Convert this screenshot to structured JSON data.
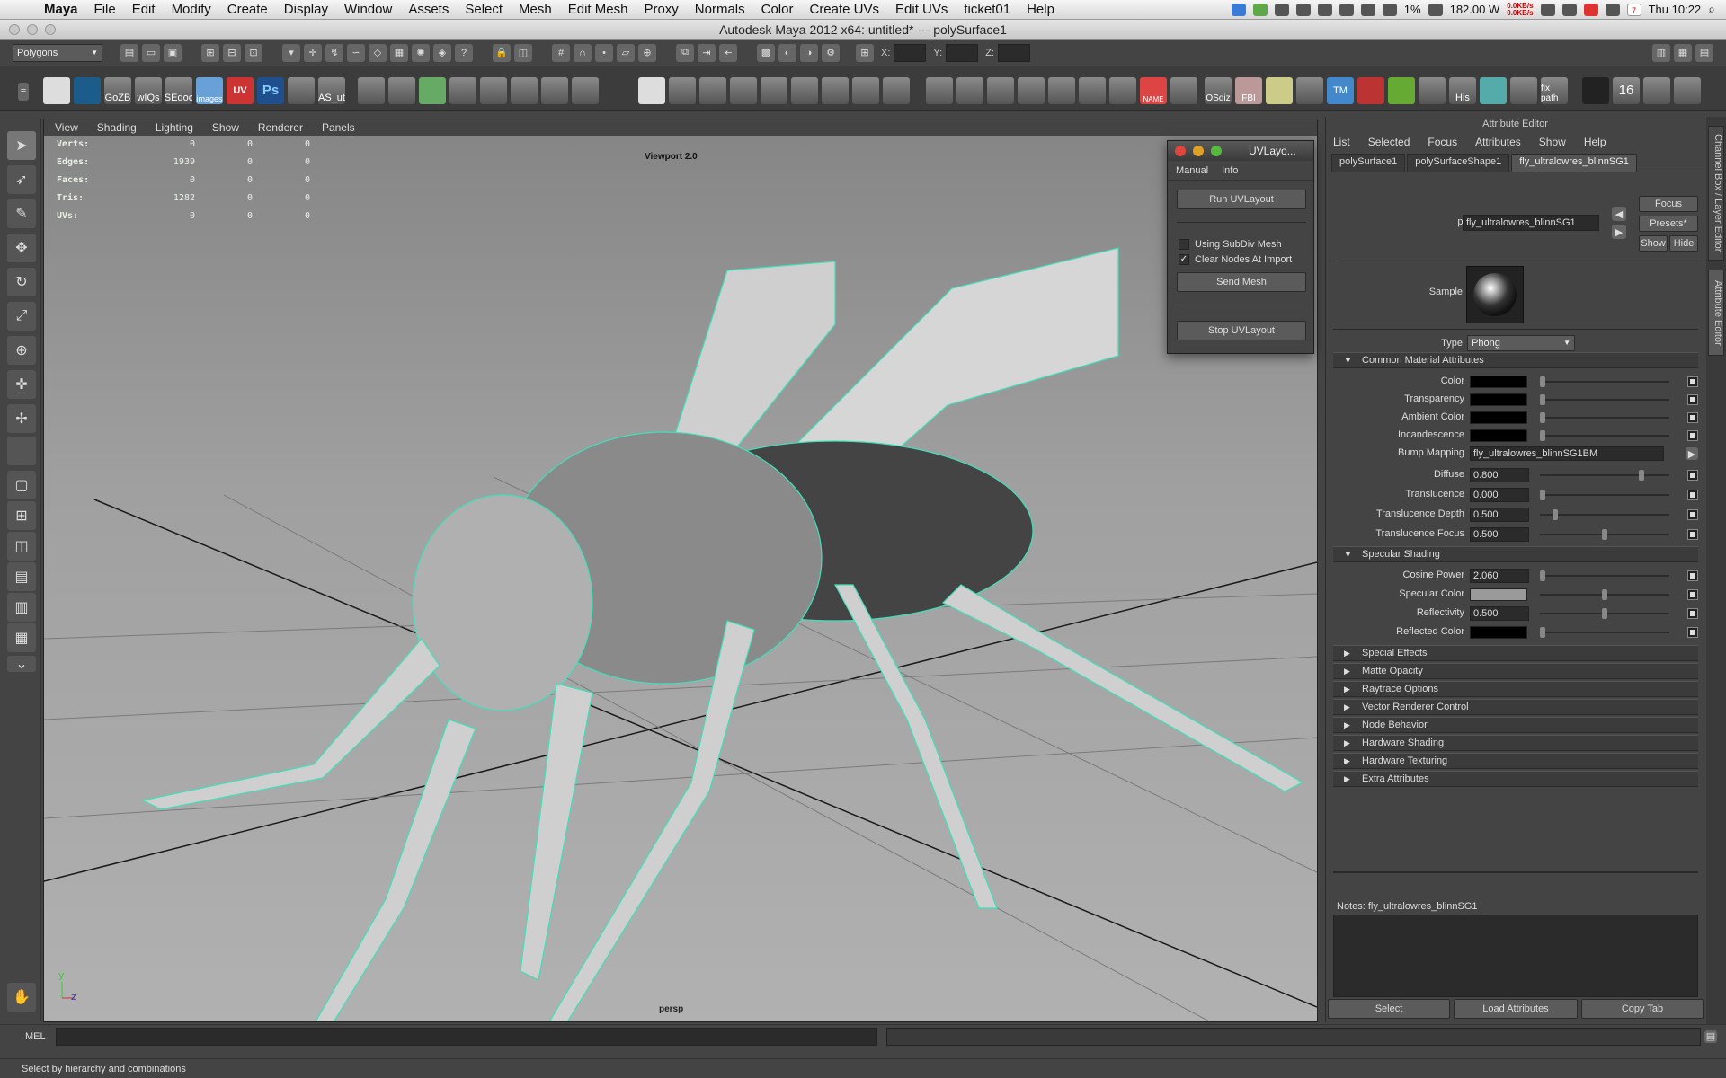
{
  "menubar": {
    "app": "Maya",
    "items": [
      "File",
      "Edit",
      "Modify",
      "Create",
      "Display",
      "Window",
      "Assets",
      "Select",
      "Mesh",
      "Edit Mesh",
      "Proxy",
      "Normals",
      "Color",
      "Create UVs",
      "Edit UVs",
      "ticket01",
      "Help"
    ],
    "battery": "1%",
    "power": "182.00 W",
    "net_up": "0.0KB/s",
    "net_down": "0.0KB/s",
    "clock": "Thu 10:22",
    "date_day": "7"
  },
  "window": {
    "title": "Autodesk Maya 2012 x64: untitled*   ---   polySurface1"
  },
  "statusline": {
    "mode": "Polygons",
    "x_label": "X:",
    "y_label": "Y:",
    "z_label": "Z:"
  },
  "shelf": {
    "icons": [
      "maya",
      "hypershade",
      "GoZB",
      "wIQs",
      "SEdoc",
      "images",
      "UV",
      "Ps",
      "AS_ut",
      "NAME",
      "OSdiz",
      "FBI",
      "TM",
      "His",
      "fix path",
      "16"
    ]
  },
  "viewport": {
    "menus": [
      "View",
      "Shading",
      "Lighting",
      "Show",
      "Renderer",
      "Panels"
    ],
    "label": "Viewport 2.0",
    "camera": "persp",
    "hud": [
      {
        "label": "Verts:",
        "values": [
          "0",
          "0",
          "0"
        ]
      },
      {
        "label": "Edges:",
        "values": [
          "1939",
          "0",
          "0"
        ]
      },
      {
        "label": "Faces:",
        "values": [
          "0",
          "0",
          "0"
        ]
      },
      {
        "label": "Tris:",
        "values": [
          "1282",
          "0",
          "0"
        ]
      },
      {
        "label": "UVs:",
        "values": [
          "0",
          "0",
          "0"
        ]
      }
    ]
  },
  "uvlayout": {
    "title": "UVLayo...",
    "menu": [
      "Manual",
      "Info"
    ],
    "run": "Run UVLayout",
    "subdiv": "Using SubDiv Mesh",
    "subdiv_checked": false,
    "clear_nodes": "Clear Nodes At Import",
    "clear_nodes_checked": true,
    "send": "Send Mesh",
    "stop": "Stop UVLayout"
  },
  "attr_editor": {
    "title": "Attribute Editor",
    "menu": [
      "List",
      "Selected",
      "Focus",
      "Attributes",
      "Show",
      "Help"
    ],
    "tabs": [
      "polySurface1",
      "polySurfaceShape1",
      "fly_ultralowres_blinnSG1"
    ],
    "node_type_label": "phong:",
    "node_name": "fly_ultralowres_blinnSG1",
    "focus": "Focus",
    "presets": "Presets*",
    "show": "Show",
    "hide": "Hide",
    "sample": "Sample",
    "type_label": "Type",
    "type_value": "Phong",
    "common_section": "Common Material Attributes",
    "common": [
      {
        "label": "Color",
        "color": "#000000"
      },
      {
        "label": "Transparency",
        "color": "#000000"
      },
      {
        "label": "Ambient Color",
        "color": "#000000"
      },
      {
        "label": "Incandescence",
        "color": "#000000"
      }
    ],
    "bump_label": "Bump Mapping",
    "bump_value": "fly_ultralowres_blinnSG1BM",
    "numeric": [
      {
        "label": "Diffuse",
        "value": "0.800",
        "fraction": 0.8
      },
      {
        "label": "Translucence",
        "value": "0.000",
        "fraction": 0.0
      },
      {
        "label": "Translucence Depth",
        "value": "0.500",
        "fraction": 0.1
      },
      {
        "label": "Translucence Focus",
        "value": "0.500",
        "fraction": 0.5
      }
    ],
    "specular_section": "Specular Shading",
    "specular": [
      {
        "label": "Cosine Power",
        "value": "2.060",
        "fraction": 0.0,
        "kind": "num"
      },
      {
        "label": "Specular Color",
        "color": "#9a9a9a",
        "fraction": 0.5,
        "kind": "color"
      },
      {
        "label": "Reflectivity",
        "value": "0.500",
        "fraction": 0.5,
        "kind": "num"
      },
      {
        "label": "Reflected Color",
        "color": "#000000",
        "fraction": 0.0,
        "kind": "color"
      }
    ],
    "collapsed": [
      "Special Effects",
      "Matte Opacity",
      "Raytrace Options",
      "Vector Renderer Control",
      "Node Behavior",
      "Hardware Shading",
      "Hardware Texturing",
      "Extra Attributes"
    ],
    "notes_label": "Notes:  fly_ultralowres_blinnSG1",
    "select": "Select",
    "load": "Load Attributes",
    "copy": "Copy Tab"
  },
  "side_tabs": [
    "Channel Box / Layer Editor",
    "Attribute Editor"
  ],
  "cmdline": {
    "label": "MEL"
  },
  "helpline": {
    "text": "Select by hierarchy and combinations"
  }
}
